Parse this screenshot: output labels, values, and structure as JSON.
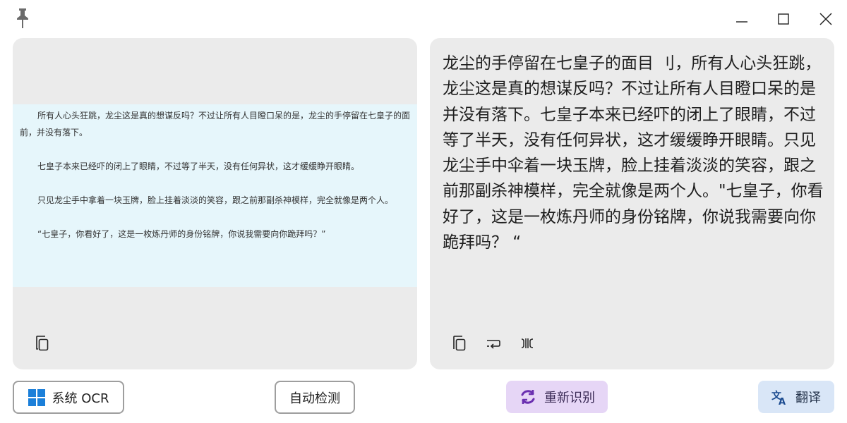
{
  "ocr_source": {
    "paragraphs": [
      "所有人心头狂跳，龙尘这是真的想谋反吗？不过让所有人目瞪口呆的是，龙尘的手停留在七皇子的面前，并没有落下。",
      "七皇子本来已经吓的闭上了眼睛，不过等了半天，没有任何异状，这才缓缓睁开眼睛。",
      "只见龙尘手中拿着一块玉牌，脸上挂着淡淡的笑容，跟之前那副杀神模样，完全就像是两个人。",
      "“七皇子，你看好了，这是一枚炼丹师的身份铭牌，你说我需要向你跪拜吗？”"
    ]
  },
  "ocr_result": {
    "text": "龙尘的手停留在七皇子的面目 刂，所有人心头狂跳，龙尘这是真的想谋反吗？不过让所有人目瞪口呆的是并没有落下。七皇子本来已经吓的闭上了眼睛，不过等了半天，没有任何异状，这才缓缓睁开眼睛。只见龙尘手中伞着一块玉牌，脸上挂着淡淡的笑容，跟之前那副杀神模样，完全就像是两个人。\"七皇子，你看好了，这是一枚炼丹师的身份铭牌，你说我需要向你跪拜吗？ “"
  },
  "toolbar": {
    "ocr_engine_label": "系统 OCR",
    "detect_label": "自动检测",
    "reocr_label": "重新识别",
    "translate_label": "翻译"
  },
  "colors": {
    "windows_blue": "#1b7fd9",
    "reocr_bg": "#e6d6f6",
    "reocr_icon": "#6a2fb0",
    "translate_bg": "#d9e6f7",
    "translate_icon": "#1a4a8f"
  }
}
